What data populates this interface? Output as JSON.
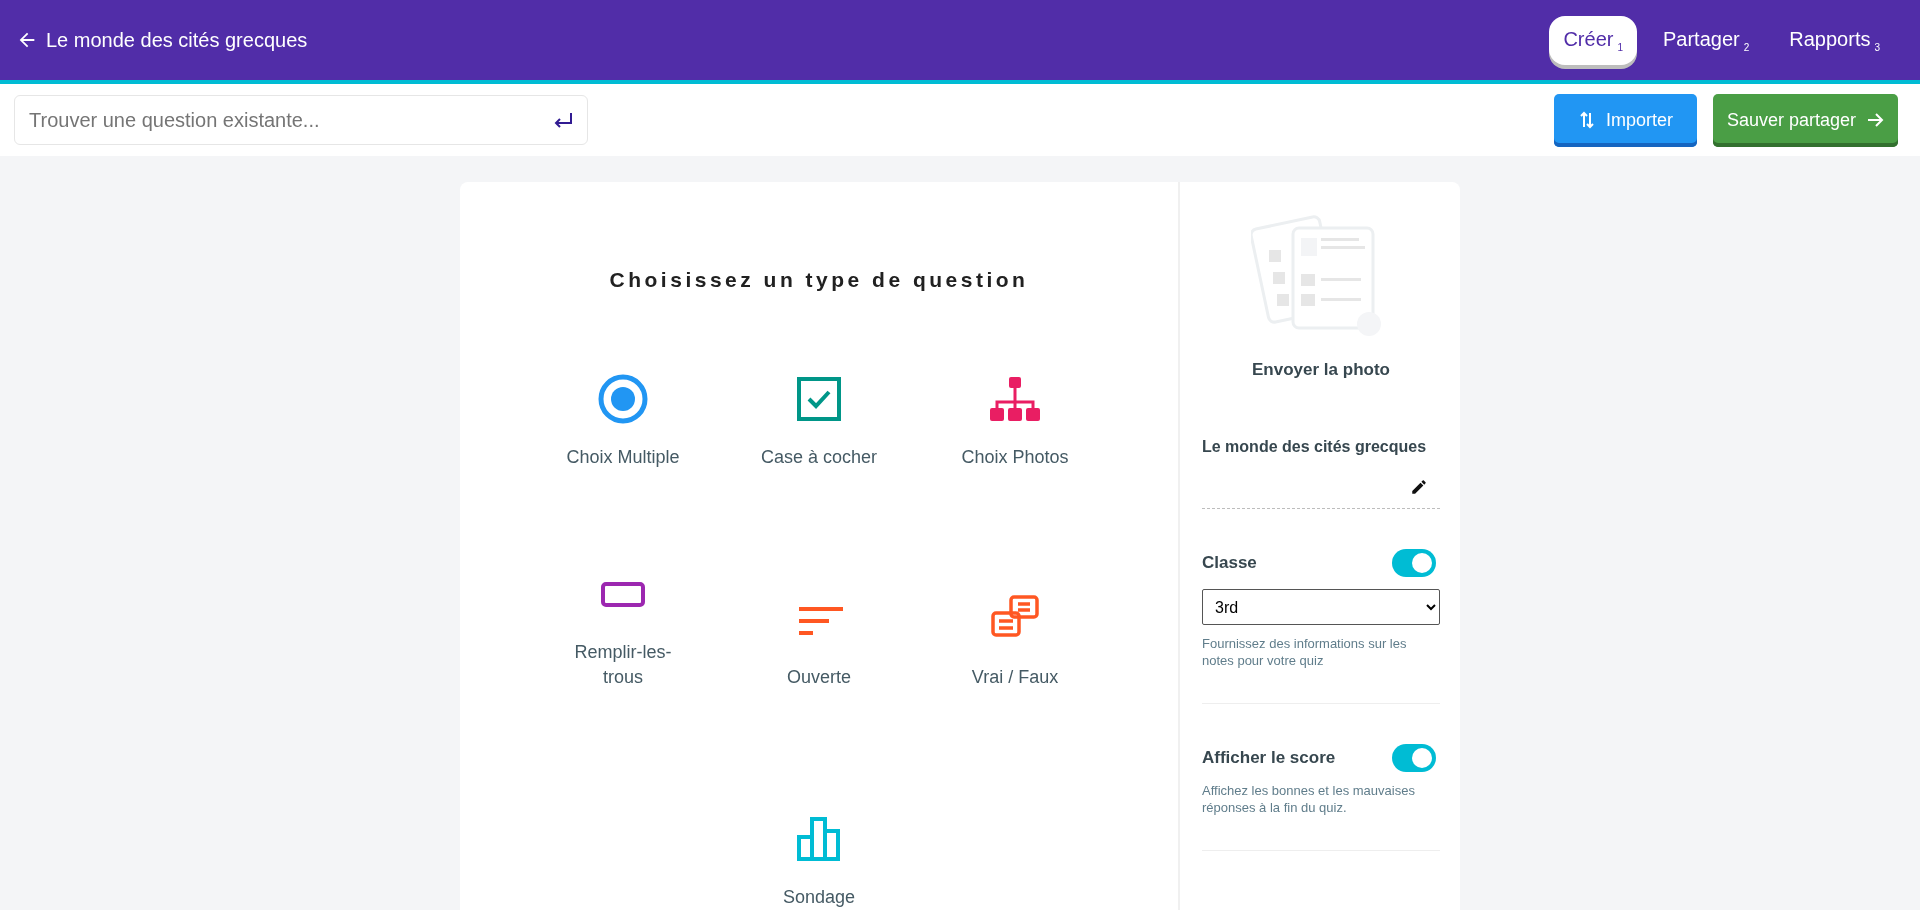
{
  "header": {
    "title": "Le monde des cités grecques"
  },
  "tabs": [
    {
      "label": "Créer",
      "step": "1",
      "selected": true
    },
    {
      "label": "Partager",
      "step": "2",
      "selected": false
    },
    {
      "label": "Rapports",
      "step": "3",
      "selected": false
    }
  ],
  "search": {
    "placeholder": "Trouver une question existante..."
  },
  "actions": [
    {
      "label": "Importer",
      "kind": "import"
    },
    {
      "label": "Sauver partager",
      "kind": "save"
    }
  ],
  "question_types": {
    "heading": "Choisissez un type de question",
    "items": [
      {
        "label": "Choix Multiple",
        "kind": "radio",
        "color": "#2196f3"
      },
      {
        "label": "Case à cocher",
        "kind": "checkbox",
        "color": "#009688"
      },
      {
        "label": "Choix Photos",
        "kind": "hierarchy",
        "color": "#e91e63"
      },
      {
        "label": "Remplir-les-trous",
        "kind": "blank",
        "color": "#9c27b0"
      },
      {
        "label": "Ouverte",
        "kind": "lines",
        "color": "#ff5722"
      },
      {
        "label": "Vrai / Faux",
        "kind": "cards",
        "color": "#ff5722"
      },
      {
        "label": "Sondage",
        "kind": "bars",
        "color": "#00bcd4"
      }
    ]
  },
  "side_panel": {
    "upload_label": "Envoyer la photo",
    "quiz_title": "Le monde des cités grecques",
    "settings": [
      {
        "label": "Classe",
        "on": true,
        "select": "3rd",
        "help": "Fournissez des informations sur les notes pour votre quiz"
      },
      {
        "label": "Afficher le score",
        "on": true,
        "help": "Affichez les bonnes et les mauvaises réponses à la fin du quiz."
      }
    ]
  }
}
